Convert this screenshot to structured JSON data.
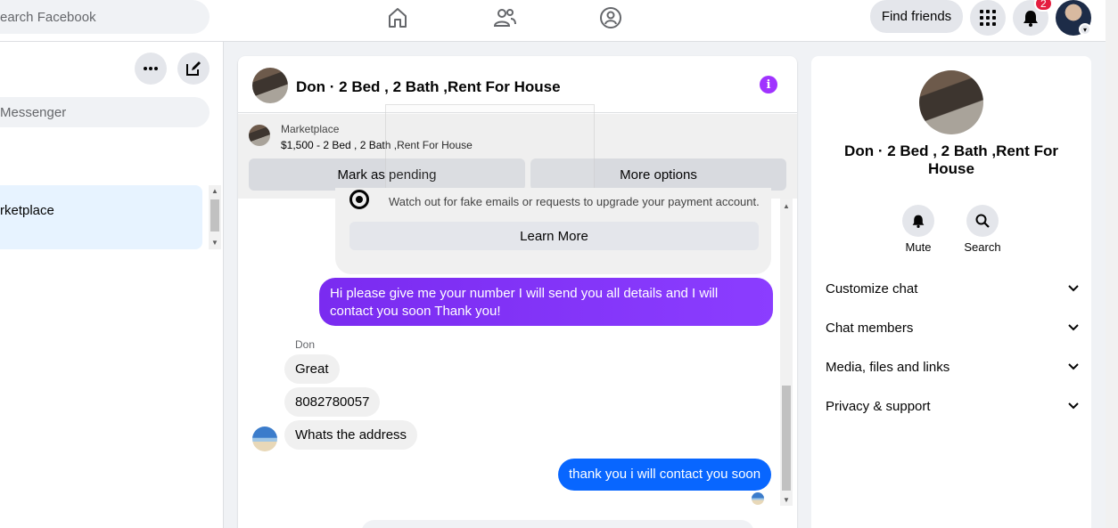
{
  "topbar": {
    "search_placeholder": "earch Facebook",
    "find_friends": "Find friends",
    "notification_count": "2"
  },
  "left": {
    "messenger_search_placeholder": "Messenger",
    "conversation_label": "rketplace"
  },
  "chat": {
    "title": "Don · 2 Bed , 2 Bath ,Rent For House",
    "marketplace_label": "Marketplace",
    "listing": "$1,500 - 2 Bed , 2 Bath ,Rent For House",
    "mark_pending": "Mark as pending",
    "more_options": "More options",
    "warning_text": "Watch out for fake emails or requests to upgrade your payment account.",
    "learn_more": "Learn More",
    "messages": {
      "out_1": "Hi please give me your number I will send you all details and I will contact you soon Thank you!",
      "sender": "Don",
      "in_1": "Great",
      "in_2": "8082780057",
      "in_3": "Whats the address",
      "out_2": "thank you i will contact you soon"
    }
  },
  "right": {
    "title": "Don · 2 Bed , 2 Bath ,Rent For House",
    "mute": "Mute",
    "search": "Search",
    "rows": [
      "Customize chat",
      "Chat members",
      "Media, files and links",
      "Privacy & support"
    ]
  },
  "colors": {
    "accent_purple": "#8b3dff",
    "accent_blue": "#0866ff",
    "info_purple": "#a033ff",
    "badge_red": "#e41e3f"
  },
  "icons": [
    "home-icon",
    "friends-icon",
    "groups-icon",
    "menu-grid-icon",
    "bell-icon",
    "more-icon",
    "compose-icon",
    "info-icon",
    "shield-icon",
    "search-icon",
    "chevron-down-icon"
  ]
}
